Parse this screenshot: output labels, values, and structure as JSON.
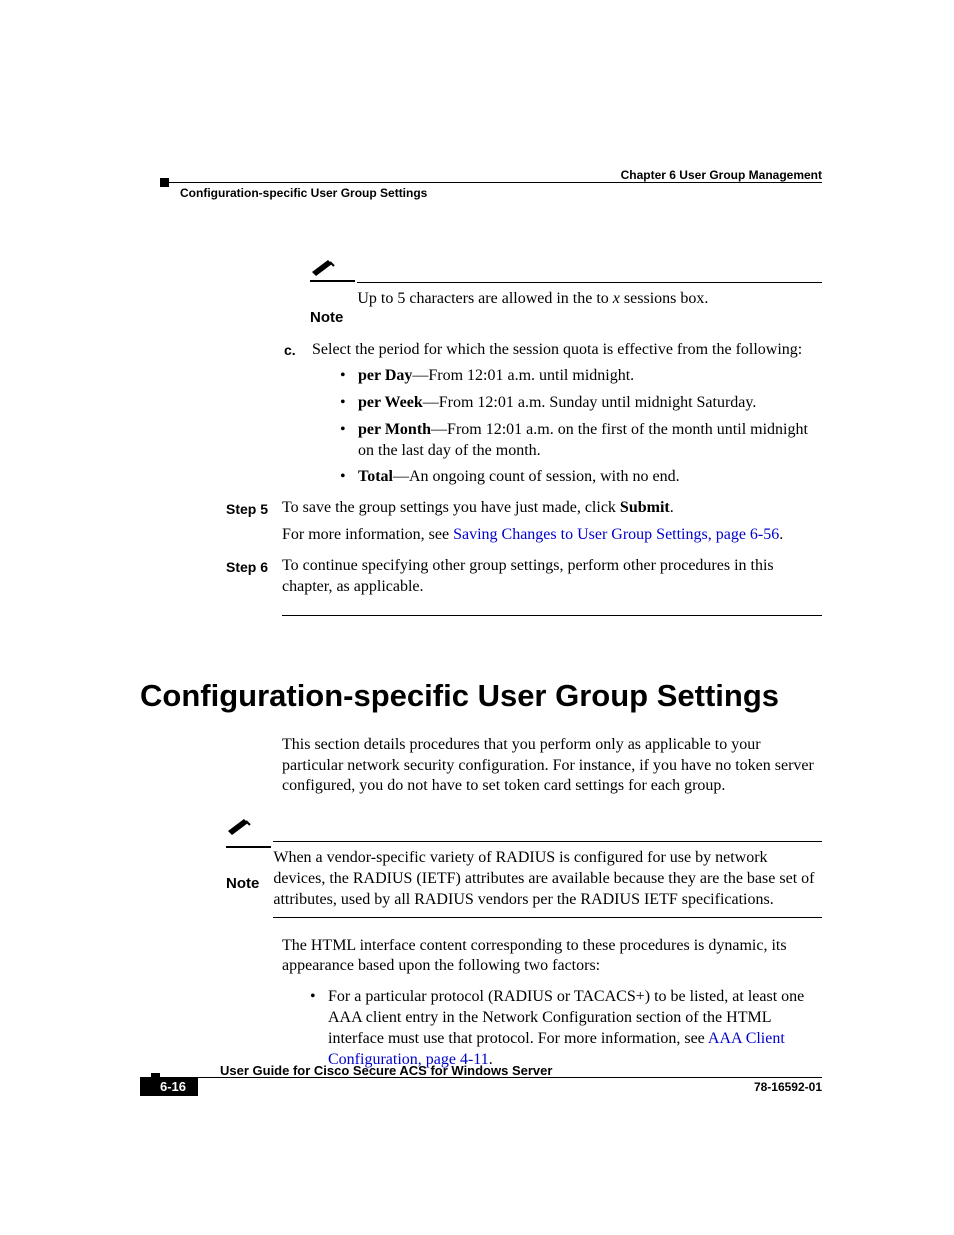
{
  "header": {
    "chapter": "Chapter 6      User Group Management",
    "section": "Configuration-specific User Group Settings"
  },
  "note_top": {
    "label": "Note",
    "text_pre": "Up to 5 characters are allowed in the to ",
    "text_var": "x",
    "text_post": " sessions box."
  },
  "sub_c": {
    "label": "c.",
    "lead": "Select the period for which the session quota is effective from the following:",
    "opts": [
      {
        "b": "per Day",
        "rest": "—From 12:01 a.m. until midnight."
      },
      {
        "b": "per Week",
        "rest": "—From 12:01 a.m. Sunday until midnight Saturday."
      },
      {
        "b": "per Month",
        "rest": "—From 12:01 a.m. on the first of the month until midnight on the last day of the month."
      },
      {
        "b": "Total",
        "rest": "—An ongoing count of session, with no end."
      }
    ]
  },
  "step5": {
    "label": "Step 5",
    "line1_pre": "To save the group settings you have just made, click ",
    "line1_b": "Submit",
    "line1_post": ".",
    "line2_pre": "For more information, see ",
    "line2_link": "Saving Changes to User Group Settings, page 6-56",
    "line2_post": "."
  },
  "step6": {
    "label": "Step 6",
    "text": "To continue specifying other group settings, perform other procedures in this chapter, as applicable."
  },
  "h1": "Configuration-specific User Group Settings",
  "intro": "This section details procedures that you perform only as applicable to your particular network security configuration. For instance, if you have no token server configured, you do not have to set token card settings for each group.",
  "note2": {
    "label": "Note",
    "text": "When a vendor-specific variety of RADIUS is configured for use by network devices, the RADIUS (IETF) attributes are available because they are the base set of attributes, used by all RADIUS vendors per the RADIUS IETF specifications."
  },
  "para2": "The HTML interface content corresponding to these procedures is dynamic, its appearance based upon the following two factors:",
  "bullet1": {
    "pre": "For a particular protocol (RADIUS or TACACS+) to be listed, at least one AAA client entry in the Network Configuration section of the HTML interface must use that protocol. For more information, see ",
    "link": "AAA Client Configuration, page 4-11",
    "post": "."
  },
  "footer": {
    "guide": "User Guide for Cisco Secure ACS for Windows Server",
    "page": "6-16",
    "doc": "78-16592-01"
  }
}
